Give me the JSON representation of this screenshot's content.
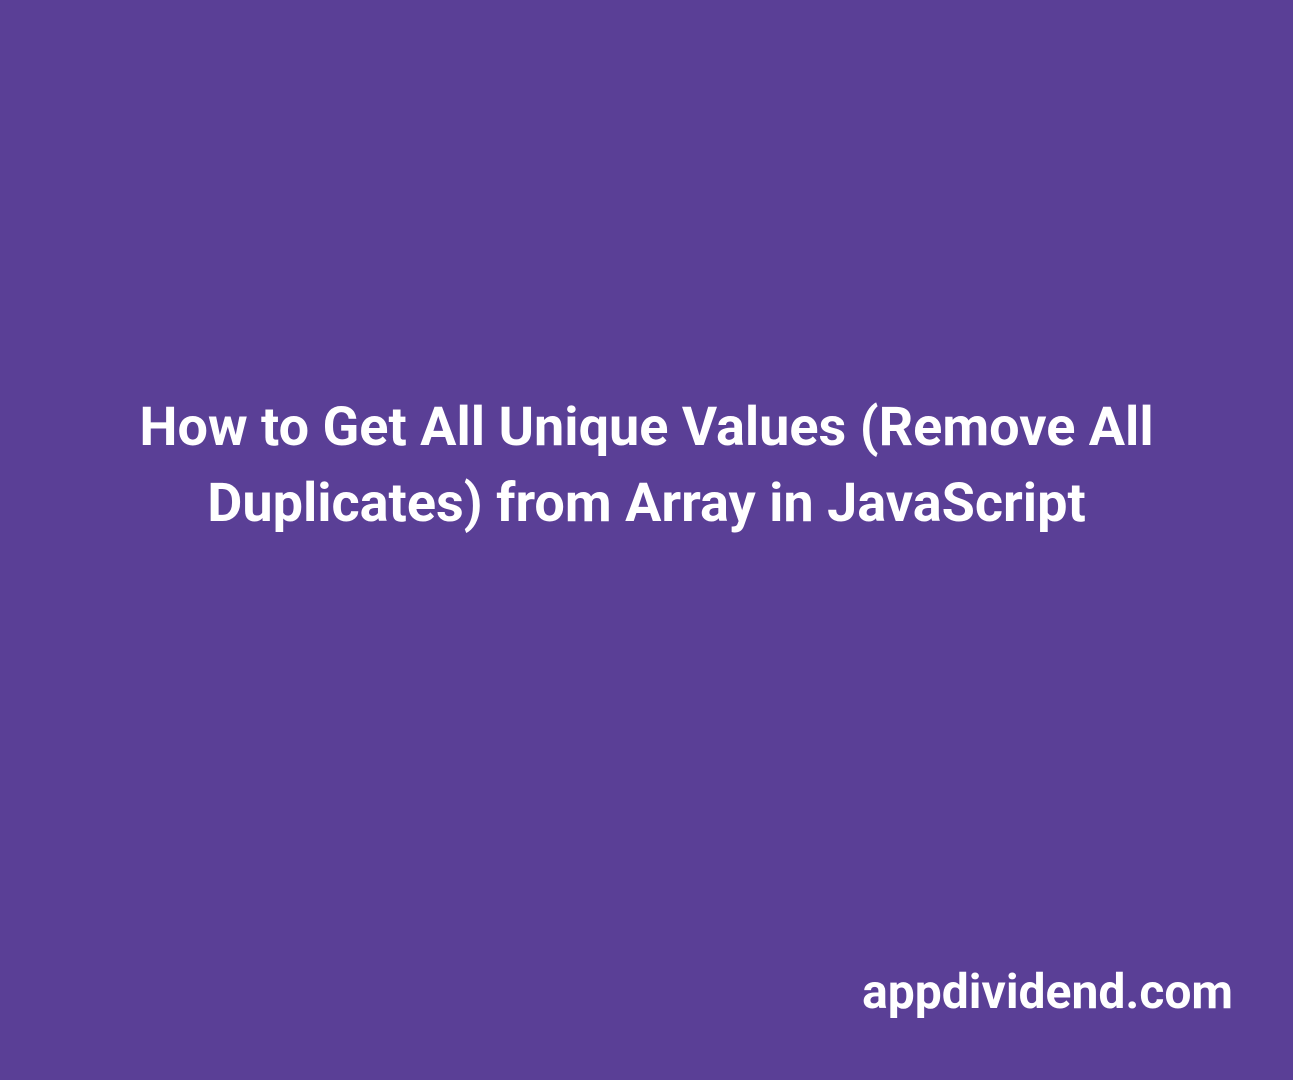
{
  "title": "How to Get All Unique Values (Remove All Duplicates) from Array in JavaScript",
  "site_name": "appdividend.com"
}
